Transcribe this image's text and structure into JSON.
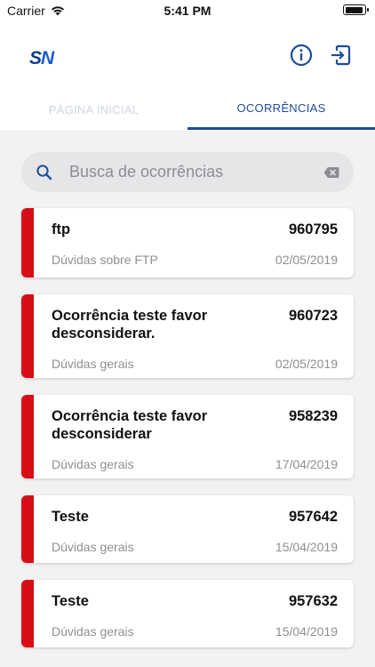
{
  "status_bar": {
    "carrier": "Carrier",
    "time": "5:41 PM"
  },
  "app": {
    "logo_s": "S",
    "logo_n": "N",
    "brand_color": "#0d3b8e"
  },
  "tabs": [
    {
      "label": "PÁGINA INICIAL",
      "active": false
    },
    {
      "label": "OCORRÊNCIAS",
      "active": true
    }
  ],
  "search": {
    "placeholder": "Busca de ocorrências",
    "value": ""
  },
  "occurrences": [
    {
      "title": "ftp",
      "number": "960795",
      "category": "Dúvidas sobre FTP",
      "date": "02/05/2019"
    },
    {
      "title": "Ocorrência teste favor desconsiderar.",
      "number": "960723",
      "category": "Dúvidas gerais",
      "date": "02/05/2019"
    },
    {
      "title": "Ocorrência teste favor desconsiderar",
      "number": "958239",
      "category": "Dúvidas gerais",
      "date": "17/04/2019"
    },
    {
      "title": "Teste",
      "number": "957642",
      "category": "Dúvidas gerais",
      "date": "15/04/2019"
    },
    {
      "title": "Teste",
      "number": "957632",
      "category": "Dúvidas gerais",
      "date": "15/04/2019"
    }
  ],
  "colors": {
    "status_bar_accent": "#d70d18",
    "tab_active": "#1e4c9a"
  }
}
